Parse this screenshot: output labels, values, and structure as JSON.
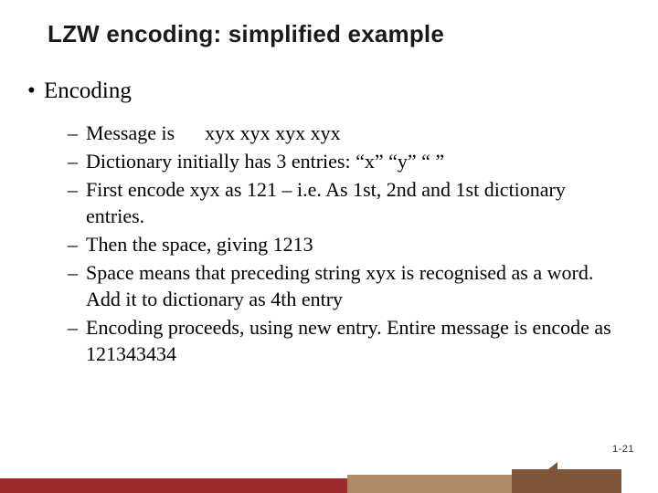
{
  "title": "LZW encoding: simplified example",
  "bullet_symbol": "•",
  "dash_symbol": "–",
  "main_point": "Encoding",
  "subpoints": [
    "Message is  xyx xyx xyx xyx",
    "Dictionary initially has 3 entries:  “x” “y” “ ”",
    "First encode xyx as 121 – i.e. As 1st, 2nd and 1st dictionary entries.",
    "Then the space, giving 1213",
    "Space means that preceding string xyx is recognised as a word.   Add it to dictionary as 4th entry",
    "Encoding proceeds, using new entry.  Entire message is encode as  121343434"
  ],
  "page_number": "1-21",
  "colors": {
    "bar_red": "#9e2a2b",
    "bar_tan": "#b08968",
    "bar_brown": "#7f5539"
  }
}
